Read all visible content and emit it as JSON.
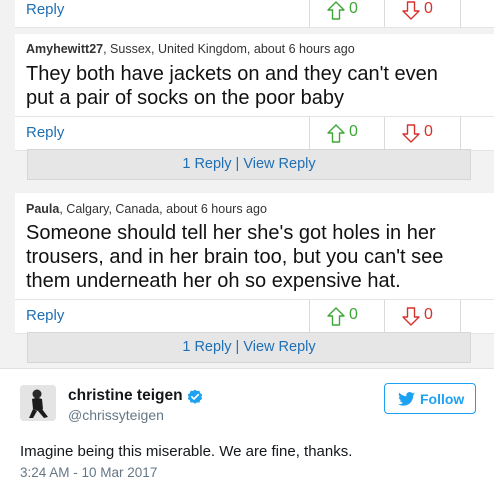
{
  "comments": [
    {
      "reply_label": "Reply",
      "up_count": "0",
      "down_count": "0"
    },
    {
      "author": "Amyhewitt27",
      "location": ", Sussex, United Kingdom, about 6 hours ago",
      "lines": [
        "They both have jackets on and they can't even",
        "put a pair of socks on the poor baby"
      ],
      "reply_label": "Reply",
      "up_count": "0",
      "down_count": "0",
      "view_replies": "1 Reply | View Reply"
    },
    {
      "author": "Paula",
      "location": ", Calgary, Canada, about 6 hours ago",
      "lines": [
        "Someone should tell her she's got holes in her",
        "trousers, and in her brain too, but you can't see",
        "them underneath her oh so expensive hat."
      ],
      "reply_label": "Reply",
      "up_count": "0",
      "down_count": "0",
      "view_replies": "1 Reply | View Reply"
    }
  ],
  "tweet": {
    "name": "christine teigen",
    "handle": "@chrissyteigen",
    "follow_label": "Follow",
    "text": "Imagine being this miserable. We are fine, thanks.",
    "timestamp": "3:24 AM - 10 Mar 2017"
  },
  "colors": {
    "link": "#1f6fb5",
    "upvote": "#3ea636",
    "downvote": "#d5322c",
    "twitter_blue": "#1da1f2"
  },
  "icons": [
    "arrow-up-icon",
    "arrow-down-icon",
    "verified-badge-icon",
    "twitter-bird-icon"
  ]
}
